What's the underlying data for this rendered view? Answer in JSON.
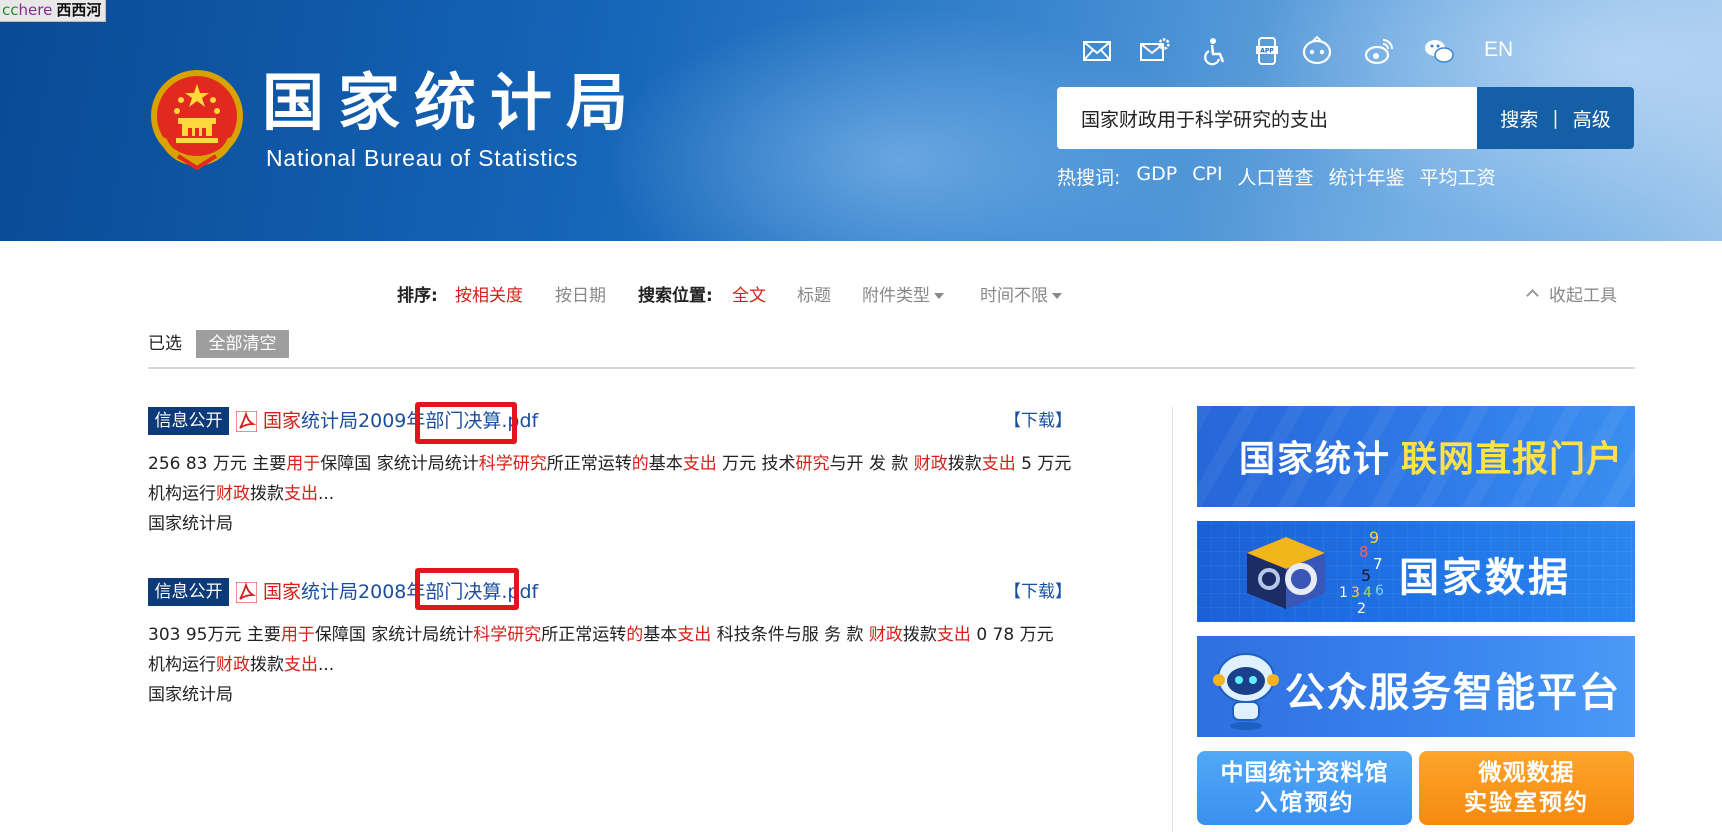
{
  "overlay": {
    "part1": "cc",
    "part2": "here",
    "part3": "西西河"
  },
  "header": {
    "logo_cn": "国家统计局",
    "logo_en": "National Bureau of Statistics",
    "lang": "EN",
    "icons": [
      "mail-icon",
      "mail-settings-icon",
      "accessibility-icon",
      "app-icon",
      "robot-icon",
      "weibo-icon",
      "wechat-icon"
    ]
  },
  "search": {
    "value": "国家财政用于科学研究的支出",
    "search_label": "搜索",
    "separator": "|",
    "advanced_label": "高级"
  },
  "hot": {
    "label": "热搜词:",
    "words": [
      "GDP",
      "CPI",
      "人口普查",
      "统计年鉴",
      "平均工资"
    ]
  },
  "toolbar": {
    "sort_label": "排序:",
    "sort_relevance": "按相关度",
    "sort_date": "按日期",
    "position_label": "搜索位置:",
    "pos_full": "全文",
    "pos_title": "标题",
    "attach_type": "附件类型",
    "time_range": "时间不限",
    "collapse": "收起工具"
  },
  "selected": {
    "label": "已选",
    "clear_all": "全部清空"
  },
  "results": [
    {
      "tag": "信息公开",
      "title_parts": [
        "国家",
        "统计局2009年部门决算.pdf"
      ],
      "download": "【下载】",
      "snippet": [
        [
          "256 83 万元 主要",
          "n"
        ],
        [
          "用于",
          "r"
        ],
        [
          "保障国 家统计局统计",
          "n"
        ],
        [
          "科学研究",
          "r"
        ],
        [
          "所正常运转",
          "n"
        ],
        [
          "的",
          "r"
        ],
        [
          "基本",
          "n"
        ],
        [
          "支出",
          "r"
        ],
        [
          " 万元 技术",
          "n"
        ],
        [
          "研究",
          "r"
        ],
        [
          "与开 发 款 ",
          "n"
        ],
        [
          "财政",
          "r"
        ],
        [
          "拨款",
          "n"
        ],
        [
          "支出",
          "r"
        ],
        [
          " 5 万元 机构运行",
          "n"
        ],
        [
          "财政",
          "r"
        ],
        [
          "拨款",
          "n"
        ],
        [
          "支出",
          "r"
        ],
        [
          "...",
          "n"
        ]
      ],
      "source": "国家统计局"
    },
    {
      "tag": "信息公开",
      "title_parts": [
        "国家",
        "统计局2008年部门决算.pdf"
      ],
      "download": "【下载】",
      "snippet": [
        [
          "303 95万元 主要",
          "n"
        ],
        [
          "用于",
          "r"
        ],
        [
          "保障国 家统计局统计",
          "n"
        ],
        [
          "科学研究",
          "r"
        ],
        [
          "所正常运转",
          "n"
        ],
        [
          "的",
          "r"
        ],
        [
          "基本",
          "n"
        ],
        [
          "支出",
          "r"
        ],
        [
          " 科技条件与服 务 款 ",
          "n"
        ],
        [
          "财政",
          "r"
        ],
        [
          "拨款",
          "n"
        ],
        [
          "支出",
          "r"
        ],
        [
          " 0 78 万元 机构运行",
          "n"
        ],
        [
          "财政",
          "r"
        ],
        [
          "拨款",
          "n"
        ],
        [
          "支出",
          "r"
        ],
        [
          "...",
          "n"
        ]
      ],
      "source": "国家统计局"
    }
  ],
  "banners": {
    "b1_left": "国家统计",
    "b1_right": "联网直报门户",
    "b2": "国家数据",
    "b3": "公众服务智能平台",
    "b4_line1": "中国统计资料馆",
    "b4_line2": "入馆预约",
    "b5_line1": "微观数据",
    "b5_line2": "实验室预约"
  },
  "colors": {
    "accent_red": "#d6201a",
    "link_blue": "#1a4e9e",
    "tag_navy": "#0d3a78",
    "search_blue": "#155fa6",
    "annotation_red": "#e4141e"
  }
}
